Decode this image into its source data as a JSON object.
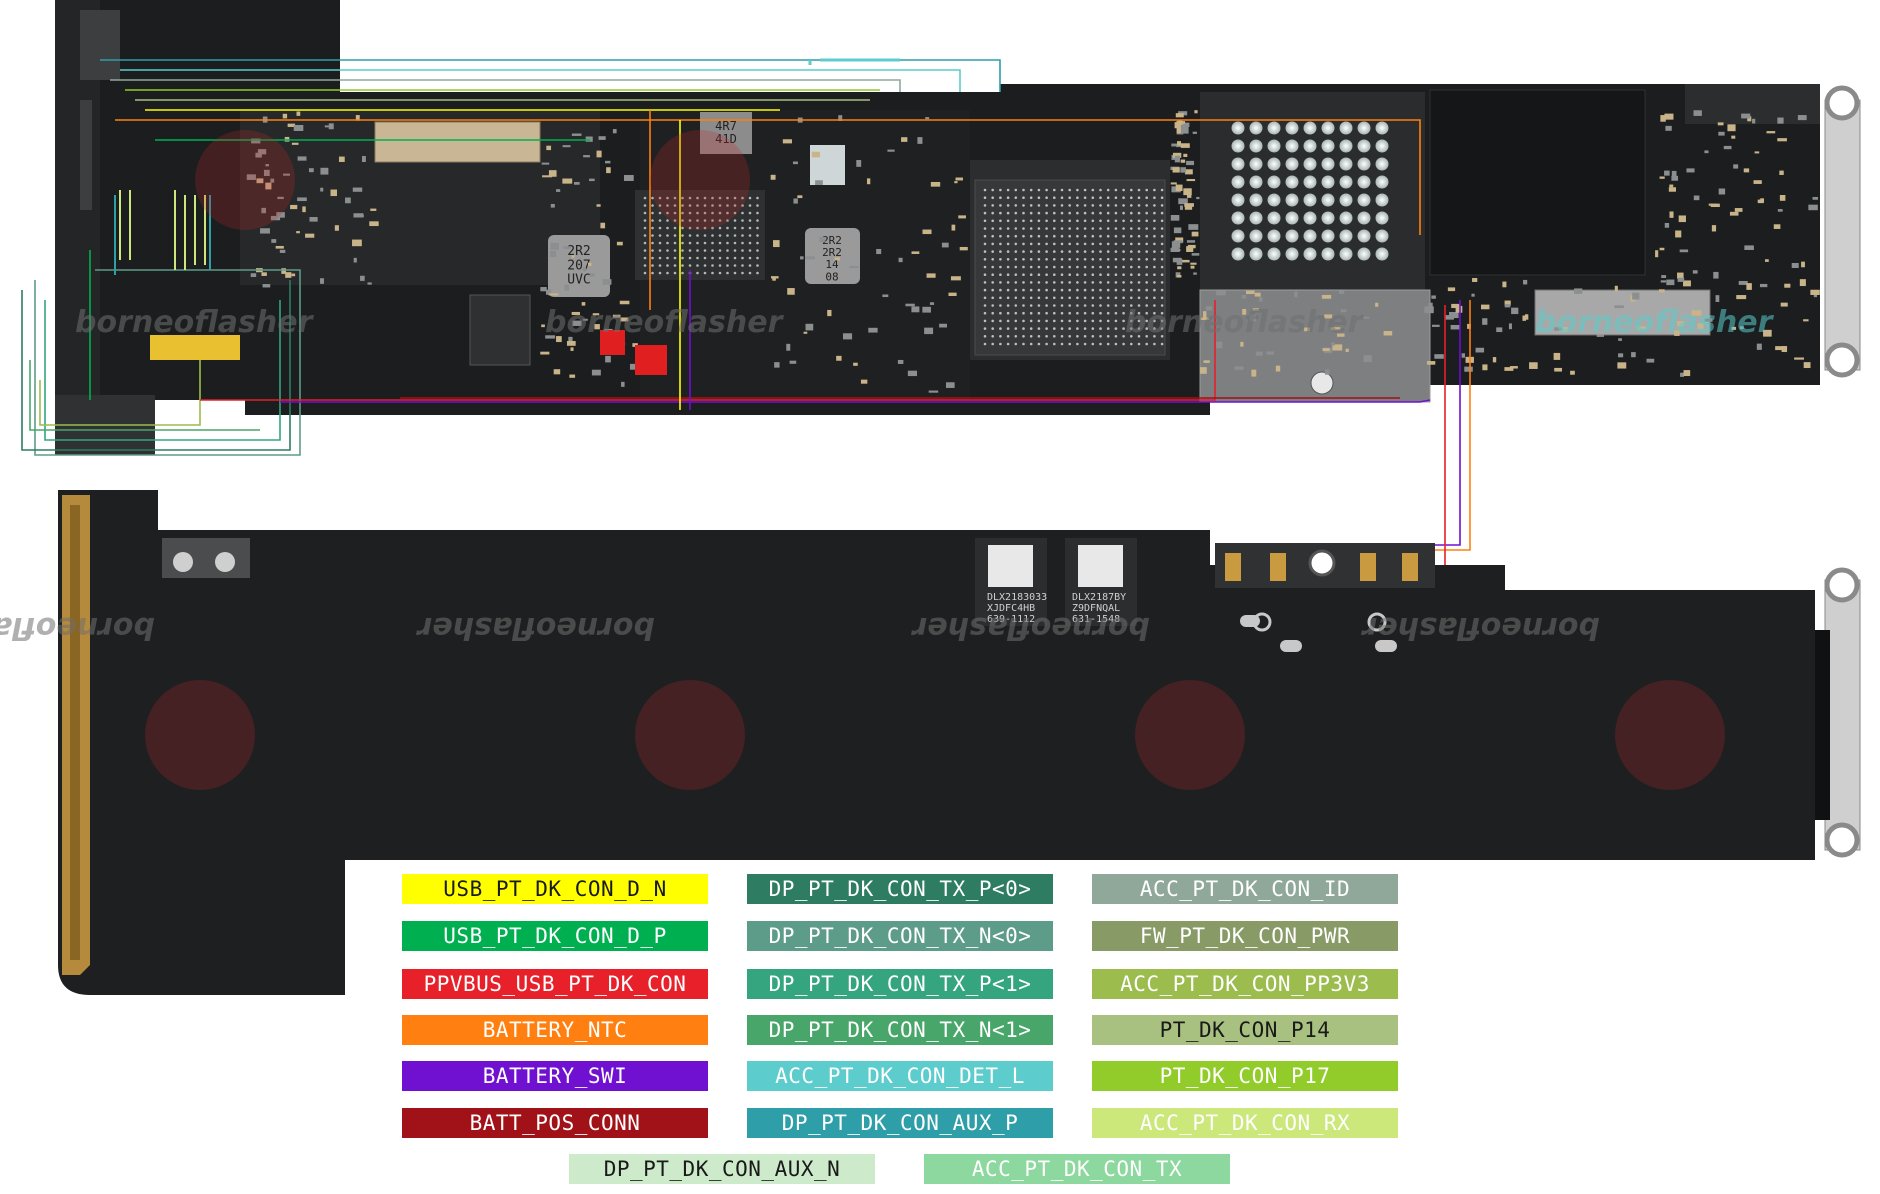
{
  "watermark": "borneoflasher",
  "chips": {
    "inductor_a": "4R7\n41D",
    "inductor_b": "2R2\n207\nUVC",
    "inductor_c": "2R2\n2R2\n14\n08",
    "label_left": "DLX2183033\nXJDFC4HB\n639-1112",
    "label_right": "DLX2187BY\nZ9DFNQAL\n631-1548"
  },
  "legend": [
    {
      "label": "USB_PT_DK_CON_D_N",
      "bg": "#FFFF00",
      "fg": "#1a1a1a"
    },
    {
      "label": "USB_PT_DK_CON_D_P",
      "bg": "#00B050",
      "fg": "#ffffff"
    },
    {
      "label": "PPVBUS_USB_PT_DK_CON",
      "bg": "#E8202A",
      "fg": "#ffffff"
    },
    {
      "label": "BATTERY_NTC",
      "bg": "#FF8010",
      "fg": "#ffffff"
    },
    {
      "label": "BATTERY_SWI",
      "bg": "#7010D0",
      "fg": "#ffffff"
    },
    {
      "label": "BATT_POS_CONN",
      "bg": "#A01218",
      "fg": "#ffffff"
    },
    {
      "label": "DP_PT_DK_CON_TX_P<0>",
      "bg": "#2E7D62",
      "fg": "#ffffff"
    },
    {
      "label": "DP_PT_DK_CON_TX_N<0>",
      "bg": "#5E9C8A",
      "fg": "#ffffff"
    },
    {
      "label": "DP_PT_DK_CON_TX_P<1>",
      "bg": "#34A57E",
      "fg": "#ffffff"
    },
    {
      "label": "DP_PT_DK_CON_TX_N<1>",
      "bg": "#49A66A",
      "fg": "#ffffff"
    },
    {
      "label": "ACC_PT_DK_CON_DET_L",
      "bg": "#5CCCCC",
      "fg": "#ffffff"
    },
    {
      "label": "DP_PT_DK_CON_AUX_P",
      "bg": "#2E9EA8",
      "fg": "#ffffff"
    },
    {
      "label": "ACC_PT_DK_CON_ID",
      "bg": "#8FA89A",
      "fg": "#ffffff"
    },
    {
      "label": "FW_PT_DK_CON_PWR",
      "bg": "#889A66",
      "fg": "#ffffff"
    },
    {
      "label": "ACC_PT_DK_CON_PP3V3",
      "bg": "#9CBC4E",
      "fg": "#ffffff"
    },
    {
      "label": "PT_DK_CON_P14",
      "bg": "#A8C080",
      "fg": "#1a1a1a"
    },
    {
      "label": "PT_DK_CON_P17",
      "bg": "#92CC2A",
      "fg": "#ffffff"
    },
    {
      "label": "ACC_PT_DK_CON_RX",
      "bg": "#CCE87A",
      "fg": "#ffffff"
    },
    {
      "label": "DP_PT_DK_CON_AUX_N",
      "bg": "#CDEBCB",
      "fg": "#1a1a1a"
    },
    {
      "label": "ACC_PT_DK_CON_TX",
      "bg": "#8CD89E",
      "fg": "#ffffff"
    }
  ]
}
